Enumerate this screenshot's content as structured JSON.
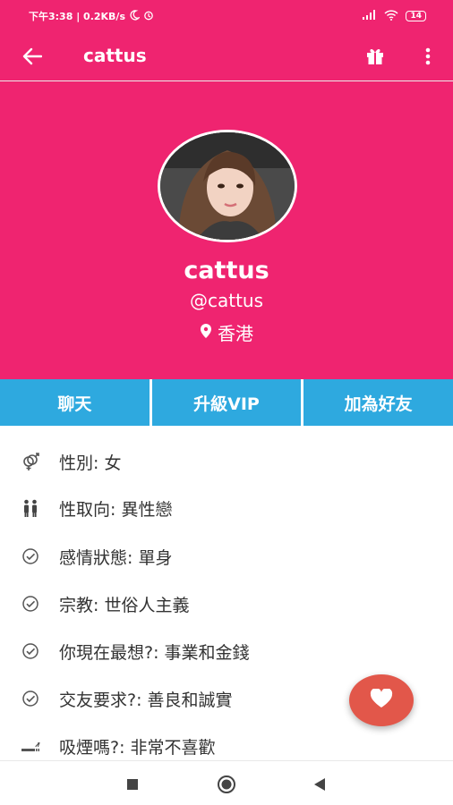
{
  "status_bar": {
    "left_text": "下午3:38 | 0.2KB/s",
    "battery": "14"
  },
  "app_bar": {
    "title": "cattus",
    "icons": [
      "back-arrow-icon",
      "gift-icon",
      "more-vert-icon"
    ]
  },
  "profile": {
    "display_name": "cattus",
    "username": "@cattus",
    "location": "香港"
  },
  "actions": {
    "chat": "聊天",
    "upgrade": "升級VIP",
    "add_friend": "加為好友"
  },
  "info": [
    {
      "icon": "gender-icon",
      "text": "性別: 女"
    },
    {
      "icon": "couple-icon",
      "text": "性取向: 異性戀"
    },
    {
      "icon": "check-circle-icon",
      "text": "感情狀態: 單身"
    },
    {
      "icon": "check-circle-icon",
      "text": "宗教: 世俗人主義"
    },
    {
      "icon": "check-circle-icon",
      "text": "你現在最想?: 事業和金錢"
    },
    {
      "icon": "check-circle-icon",
      "text": "交友要求?: 善良和誠實"
    },
    {
      "icon": "smoking-icon",
      "text": "吸煙嗎?: 非常不喜歡"
    }
  ],
  "colors": {
    "primary": "#ef2470",
    "button_blue": "#2ea9df",
    "fab": "#e2574a",
    "text": "#333333"
  }
}
